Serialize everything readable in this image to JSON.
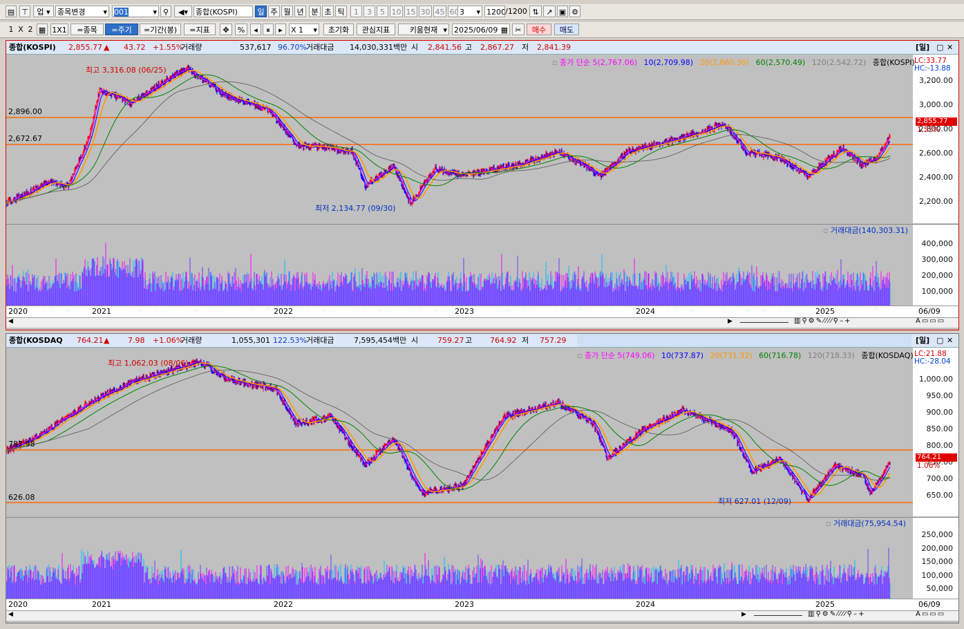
{
  "toolbar1": {
    "market_label": "업",
    "stock_change": "종목변경",
    "code_input": "001",
    "index_name": "종합(KOSPI)",
    "periods": [
      "일",
      "주",
      "월",
      "년",
      "분",
      "초",
      "틱"
    ],
    "selected_period": "일",
    "intervals": [
      "1",
      "3",
      "5",
      "10",
      "15",
      "30",
      "45",
      "60"
    ],
    "count_value": "3",
    "count_display": "1200",
    "count_total": "/1200"
  },
  "toolbar2": {
    "layout_1": "1",
    "layout_x": "X",
    "layout_2": "2",
    "layout_1x1": "1X1",
    "btn_stock": "=종목",
    "btn_period": "=주기",
    "btn_range": "=기간(봉)",
    "btn_indicator": "=지표",
    "pct_label": "%",
    "multiplier": "X 1",
    "btn_reset": "초기화",
    "btn_interest": "관심지표",
    "btn_kiwoom": "키움현재",
    "date_value": "2025/06/09",
    "btn_buy": "매수",
    "btn_sell": "매도"
  },
  "kospi": {
    "name": "종합(KOSPI)",
    "price": "2,855.77",
    "arrow": "▲",
    "change": "43.72",
    "change_pct": "+1.55%",
    "volume_label": "거래량",
    "volume": "537,617",
    "volume_ratio": "96.70%",
    "amount_label": "거래대금",
    "amount": "14,030,331백만",
    "open_label": "시",
    "open": "2,841.56",
    "high_label": "고",
    "high": "2,867.27",
    "low_label": "저",
    "low": "2,841.39",
    "tab": "[일]",
    "legend": {
      "ma_title": "종가 단순 5",
      "ma5": "(2,767.06)",
      "ma10": "10(2,709.98)",
      "ma20": "20(2,660.30)",
      "ma60": "60(2,570.49)",
      "ma120": "120(2,542.72)",
      "series": "종합(KOSPI)"
    },
    "lc": "LC:33.77",
    "hc": "HC:-13.88",
    "price_tag": "2,855.77",
    "price_pct": "1.55%",
    "hline_upper": "2,896.00",
    "hline_lower": "2,672.67",
    "high_ann": "최고 3,316.08 (06/25)",
    "low_ann": "최저 2,134.77 (09/30)",
    "y_ticks": [
      "3,200.00",
      "3,000.00",
      "2,800.00",
      "2,600.00",
      "2,400.00",
      "2,200.00"
    ],
    "vol_legend": "거래대금(140,303.31)",
    "vol_ticks": [
      "400,000",
      "300,000",
      "200,000",
      "100,000"
    ],
    "x_labels": [
      "2020",
      "2021",
      "2022",
      "2023",
      "2024",
      "2025"
    ],
    "x_end": "06/09"
  },
  "kosdaq": {
    "name": "종합(KOSDAQ",
    "price": "764.21",
    "arrow": "▲",
    "change": "7.98",
    "change_pct": "+1.06%",
    "volume_label": "거래량",
    "volume": "1,055,301",
    "volume_ratio": "122.53%",
    "amount_label": "거래대금",
    "amount": "7,595,454백만",
    "open_label": "시",
    "open": "759.27",
    "high_label": "고",
    "high": "764.92",
    "low_label": "저",
    "low": "757.29",
    "tab": "[일]",
    "legend": {
      "ma_title": "종가 단순 5",
      "ma5": "(749.06)",
      "ma10": "10(737.87)",
      "ma20": "20(731.32)",
      "ma60": "60(716.78)",
      "ma120": "120(718.33)",
      "series": "종합(KOSDAQ)"
    },
    "lc": "LC:21.88",
    "hc": "HC:-28.04",
    "price_tag": "764.21",
    "price_pct": "1.06%",
    "hline_upper": "787.98",
    "hline_lower": "626.08",
    "high_ann": "최고 1,062.03 (08/06)",
    "low_ann": "최저 627.01 (12/09)",
    "y_ticks": [
      "1,000.00",
      "950.00",
      "900.00",
      "850.00",
      "800.00",
      "750.00",
      "700.00",
      "650.00"
    ],
    "vol_legend": "거래대금(75,954.54)",
    "vol_ticks": [
      "250,000",
      "200,000",
      "150,000",
      "100,000",
      "50,000"
    ],
    "x_labels": [
      "2020",
      "2021",
      "2022",
      "2023",
      "2024",
      "2025"
    ],
    "x_end": "06/09"
  },
  "colors": {
    "ma5": "#ff00ff",
    "ma10": "#0000ff",
    "ma20": "#ff9900",
    "ma60": "#008000",
    "ma120": "#808080",
    "hline": "#ff6600",
    "up": "#ff0000",
    "down": "#0000ff"
  }
}
